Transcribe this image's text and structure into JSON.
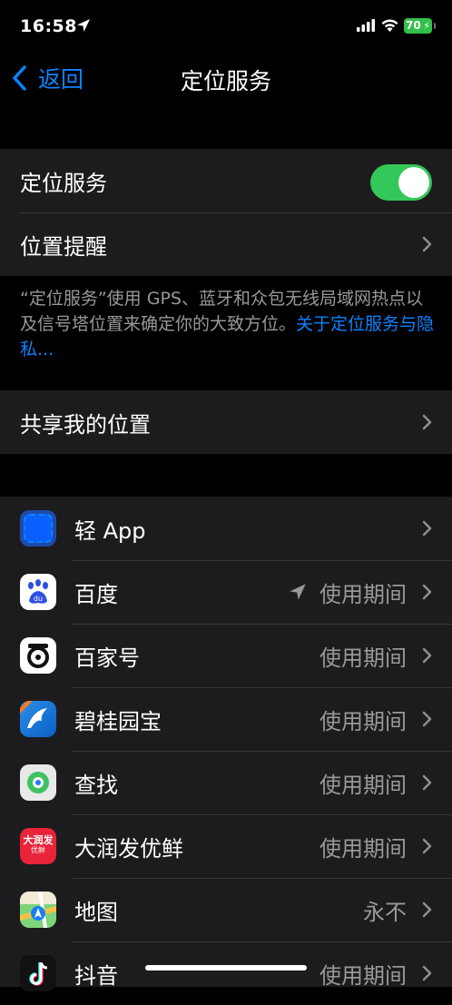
{
  "status_bar": {
    "time": "16:58",
    "battery": "70"
  },
  "nav": {
    "back_label": "返回",
    "title": "定位服务"
  },
  "location_services": {
    "label": "定位服务",
    "enabled": true
  },
  "location_alerts": {
    "label": "位置提醒"
  },
  "footer": {
    "text": "“定位服务”使用 GPS、蓝牙和众包无线局域网热点以及信号塔位置来确定你的大致方位。",
    "link": "关于定位服务与隐私..."
  },
  "share_location": {
    "label": "共享我的位置"
  },
  "apps": [
    {
      "name": "轻 App",
      "value": "",
      "icon": "light-app-icon"
    },
    {
      "name": "百度",
      "value": "使用期间",
      "icon": "baidu-icon",
      "recent_use": true
    },
    {
      "name": "百家号",
      "value": "使用期间",
      "icon": "baijiahao-icon"
    },
    {
      "name": "碧桂园宝",
      "value": "使用期间",
      "icon": "biguiyuanbao-icon"
    },
    {
      "name": "查找",
      "value": "使用期间",
      "icon": "find-my-icon"
    },
    {
      "name": "大润发优鲜",
      "value": "使用期间",
      "icon": "rt-mart-icon",
      "icon_text": "大润发",
      "icon_subtext": "优鲜"
    },
    {
      "name": "地图",
      "value": "永不",
      "icon": "maps-icon"
    },
    {
      "name": "抖音",
      "value": "使用期间",
      "icon": "douyin-icon"
    }
  ],
  "colors": {
    "accent": "#0a84ff",
    "toggle_on": "#34c759",
    "cell_bg": "#1c1c1e",
    "secondary_text": "#98989d"
  }
}
